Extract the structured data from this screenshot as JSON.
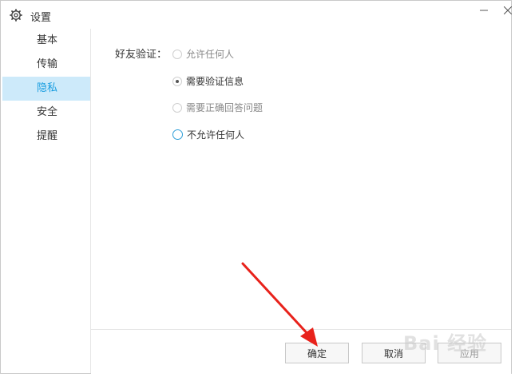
{
  "window": {
    "title": "设置",
    "icon": "gear-icon"
  },
  "sidebar": {
    "items": [
      {
        "label": "基本",
        "active": false
      },
      {
        "label": "传输",
        "active": false
      },
      {
        "label": "隐私",
        "active": true
      },
      {
        "label": "安全",
        "active": false
      },
      {
        "label": "提醒",
        "active": false
      }
    ]
  },
  "privacy": {
    "friend_verify_label": "好友验证：",
    "options": [
      {
        "label": "允许任何人",
        "checked": false
      },
      {
        "label": "需要验证信息",
        "checked": true
      },
      {
        "label": "需要正确回答问题",
        "checked": false
      },
      {
        "label": "不允许任何人",
        "checked": false
      }
    ]
  },
  "footer": {
    "ok_label": "确定",
    "cancel_label": "取消",
    "apply_label": "应用"
  },
  "watermark": {
    "text": "Bai 经验"
  },
  "colors": {
    "accent": "#1a9ee0",
    "active_bg": "#cdeafa",
    "arrow": "#e8221b"
  }
}
